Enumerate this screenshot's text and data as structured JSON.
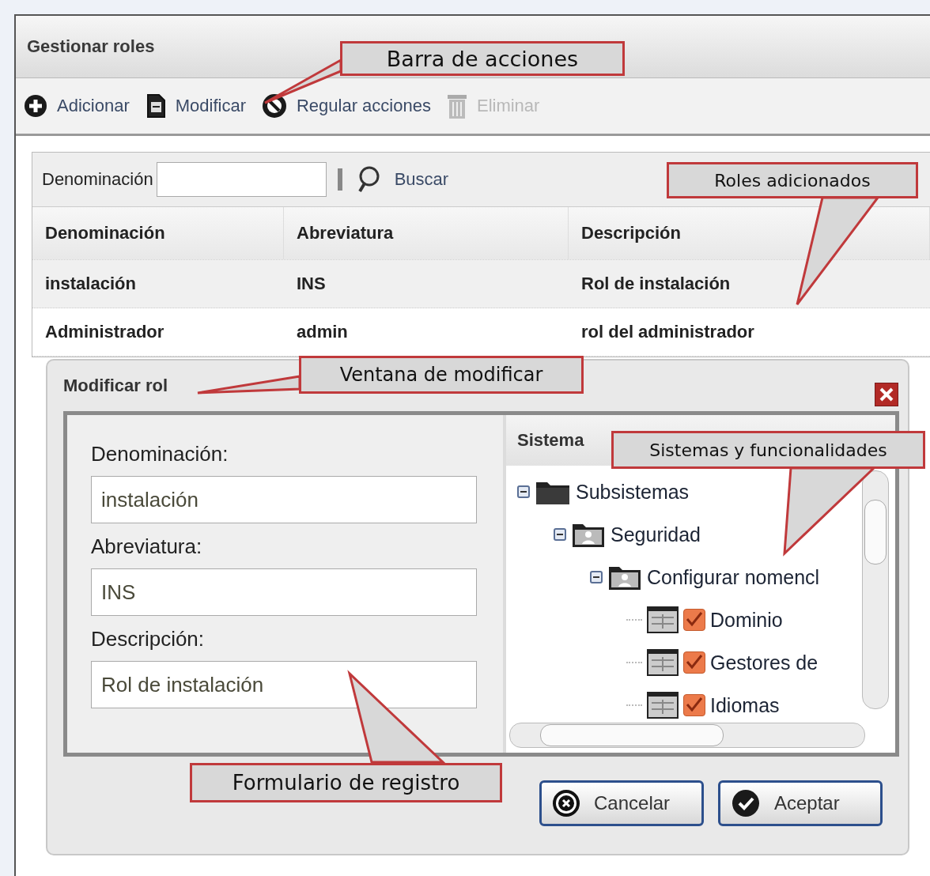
{
  "panel": {
    "title": "Gestionar roles"
  },
  "toolbar": [
    {
      "label": "Adicionar",
      "kind": "add",
      "disabled": false
    },
    {
      "label": "Modificar",
      "kind": "edit",
      "disabled": false
    },
    {
      "label": "Regular acciones",
      "kind": "block",
      "disabled": false
    },
    {
      "label": "Eliminar",
      "kind": "delete",
      "disabled": true
    }
  ],
  "search": {
    "label": "Denominación",
    "button": "Buscar"
  },
  "table": {
    "columns": [
      "Denominación",
      "Abreviatura",
      "Descripción"
    ],
    "rows": [
      {
        "cells": [
          "instalación",
          "INS",
          "Rol de instalación"
        ],
        "selected": true
      },
      {
        "cells": [
          "Administrador",
          "admin",
          "rol del administrador"
        ],
        "selected": false
      }
    ]
  },
  "dialog": {
    "title": "Modificar rol",
    "fields": [
      {
        "label": "Denominación:",
        "value": "instalación"
      },
      {
        "label": "Abreviatura:",
        "value": "INS"
      },
      {
        "label": "Descripción:",
        "value": "Rol de instalación"
      }
    ],
    "tree": {
      "title": "Sistema",
      "items": [
        {
          "label": "Subsistemas",
          "kind": "folder",
          "expanded": true,
          "children": [
            {
              "label": "Seguridad",
              "kind": "group",
              "expanded": true,
              "children": [
                {
                  "label": "Configurar nomencl",
                  "kind": "group",
                  "expanded": true,
                  "children": [
                    {
                      "label": "Dominio",
                      "kind": "leaf",
                      "checked": true
                    },
                    {
                      "label": "Gestores de",
                      "kind": "leaf",
                      "checked": true
                    },
                    {
                      "label": "Idiomas",
                      "kind": "leaf",
                      "checked": true
                    }
                  ]
                }
              ]
            }
          ]
        }
      ]
    },
    "buttons": [
      {
        "label": "Cancelar",
        "kind": "cancel"
      },
      {
        "label": "Aceptar",
        "kind": "accept"
      }
    ]
  },
  "callouts": [
    {
      "text": "Barra de acciones"
    },
    {
      "text": "Roles adicionados"
    },
    {
      "text": "Ventana de modificar"
    },
    {
      "text": "Sistemas y funcionalidades"
    },
    {
      "text": "Formulario de registro"
    }
  ]
}
